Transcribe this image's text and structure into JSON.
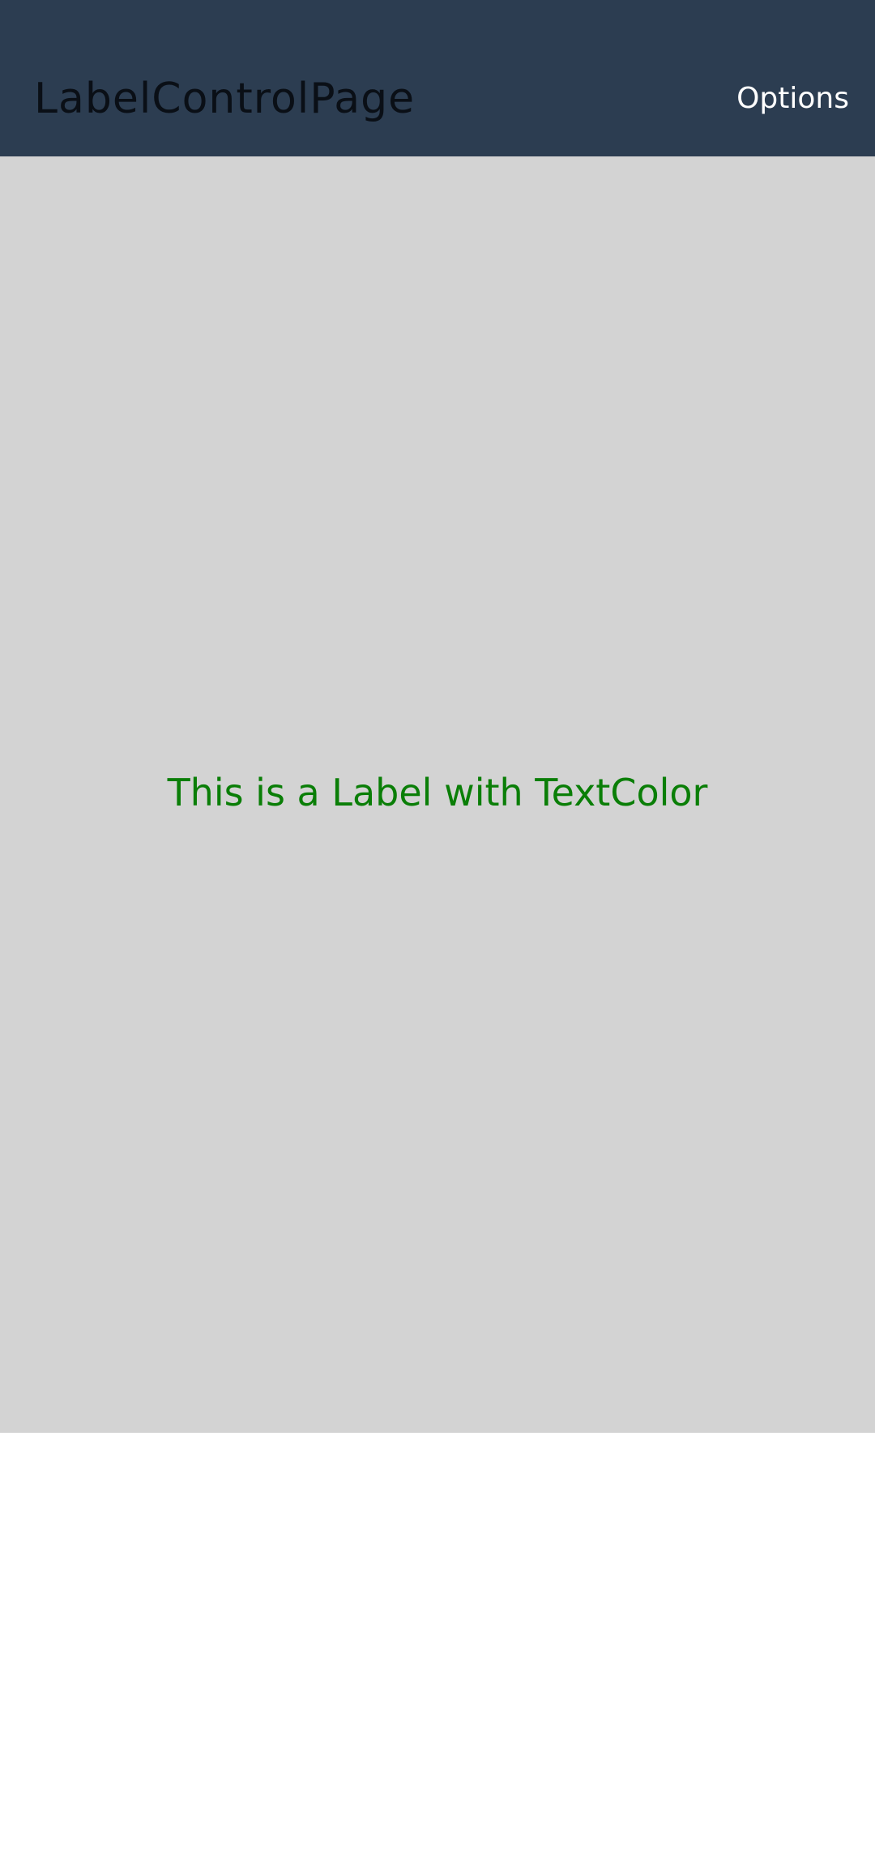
{
  "app_bar": {
    "title": "LabelControlPage",
    "options_label": "Options"
  },
  "content": {
    "label_text": "This is a Label with TextColor"
  },
  "colors": {
    "app_bar_background": "#2c3d51",
    "title_text": "#0a0f16",
    "options_text": "#ffffff",
    "content_background": "#d3d3d3",
    "label_text": "#0a7e07",
    "page_background": "#ffffff"
  }
}
